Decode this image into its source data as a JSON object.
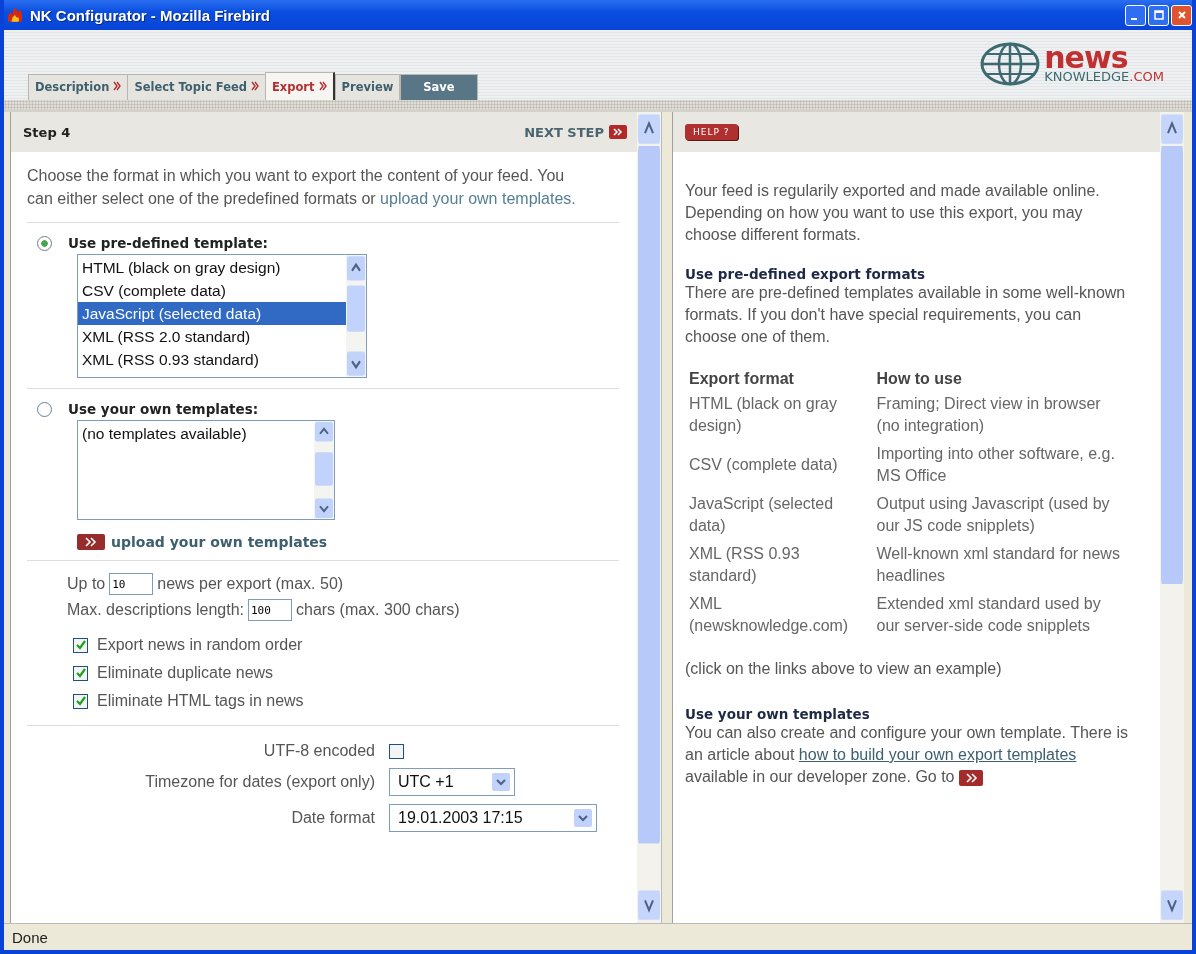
{
  "window": {
    "title": "NK Configurator - Mozilla Firebird"
  },
  "tabs": [
    {
      "label": "Description",
      "kind": "step",
      "selected": false
    },
    {
      "label": "Select Topic Feed",
      "kind": "step",
      "selected": false
    },
    {
      "label": "Export",
      "kind": "step",
      "selected": true
    },
    {
      "label": "Preview",
      "kind": "plain",
      "selected": false
    },
    {
      "label": "Save",
      "kind": "save",
      "selected": false
    }
  ],
  "logo": {
    "name": "news",
    "domain": "KNOWLEDGE",
    "tld": ".COM"
  },
  "left": {
    "step_title": "Step 4",
    "next_step": "NEXT STEP",
    "intro": "Choose the format in which you want to export the content of your feed. You can either select one of the predefined formats or",
    "intro_link": "upload your own templates.",
    "options": [
      {
        "label": "Use pre-defined template:",
        "selected": true,
        "items": [
          {
            "text": "HTML (black on gray design)",
            "selected": false
          },
          {
            "text": "CSV (complete data)",
            "selected": false
          },
          {
            "text": "JavaScript (selected data)",
            "selected": true
          },
          {
            "text": "XML (RSS 2.0 standard)",
            "selected": false
          },
          {
            "text": "XML (RSS 0.93 standard)",
            "selected": false
          }
        ]
      },
      {
        "label": "Use your own templates:",
        "selected": false,
        "items": [
          {
            "text": "(no templates available)",
            "selected": false
          }
        ]
      }
    ],
    "upload_link": "upload your own templates",
    "inputs": [
      {
        "prefix": "Up to",
        "value": "10",
        "suffix": "news per export (max. 50)"
      },
      {
        "prefix": "Max. descriptions length:",
        "value": "100",
        "suffix": "chars (max. 300 chars)"
      }
    ],
    "checkboxes": [
      {
        "label": "Export news in random order",
        "checked": true
      },
      {
        "label": "Eliminate duplicate news",
        "checked": true
      },
      {
        "label": "Eliminate HTML tags in news",
        "checked": true
      }
    ],
    "utf8": {
      "label": "UTF-8 encoded",
      "checked": false
    },
    "selects": [
      {
        "label": "Timezone for dates (export only)",
        "value": "UTC +1"
      },
      {
        "label": "Date format",
        "value": "19.01.2003 17:15"
      }
    ]
  },
  "right": {
    "help_button": "HELP ?",
    "intro": "Your feed is regularily exported and made available online. Depending on how you want to use this export, you may choose different formats.",
    "predefined_heading": "Use pre-defined export formats",
    "predefined_text": "There are pre-defined templates available in some well-known formats. If you don't have special requirements, you can choose one of them.",
    "table": {
      "columns": [
        "Export format",
        "How to use"
      ],
      "rows": [
        [
          "HTML (black on gray design)",
          "Framing; Direct view in browser (no integration)"
        ],
        [
          "CSV (complete data)",
          "Importing into other software, e.g. MS Office"
        ],
        [
          "JavaScript (selected data)",
          "Output using Javascript (used by our JS code snipplets)"
        ],
        [
          "XML (RSS 0.93 standard)",
          "Well-known xml standard for news headlines"
        ],
        [
          "XML (newsknowledge.com)",
          "Extended xml standard used by our server-side code snipplets"
        ]
      ]
    },
    "note": "(click on the links above to view an example)",
    "own_heading": "Use your own templates",
    "own_text_before": "You can also create and configure your own template. There is an article about",
    "own_link": "how to build your own export templates",
    "own_text_after": "available in our developer zone. Go to"
  },
  "status_bar": "Done"
}
